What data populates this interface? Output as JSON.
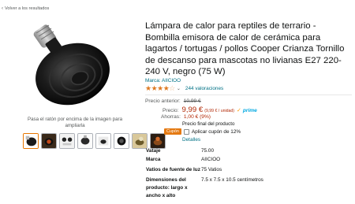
{
  "nav": {
    "back_label": "Volver a los resultados"
  },
  "gallery": {
    "hint": "Pasa el ratón por encima de la imagen para ampliarla",
    "thumbnail_count": 8
  },
  "product": {
    "title": "Lámpara de calor para reptiles de terrario - Bombilla emisora de calor de cerámica para lagartos / tortugas / pollos Cooper Crianza Tornillo de descanso para mascotas no livianas E27 220-240 V, negro (75 W)",
    "brand_link": "Marca: AIICIOO",
    "rating_stars": 4,
    "reviews": "244 valoraciones"
  },
  "pricing": {
    "previous_label": "Precio anterior:",
    "previous_value": "10,99 €",
    "price_label": "Precio:",
    "price_value": "9,99 €",
    "unit_price": "(9,99 € / unidad)",
    "prime": "prime",
    "savings_label": "Ahorras:",
    "savings_value": "1,00 € (9%)",
    "final_note": "Precio final del producto"
  },
  "coupon": {
    "badge": "Cupón",
    "apply_label": "Aplicar cupón de 12%",
    "details_link": "Detalles"
  },
  "specs": [
    {
      "key": "Vataje",
      "value": "75.00"
    },
    {
      "key": "Marca",
      "value": "AIICIOO"
    },
    {
      "key": "Vatios de fuente de luz",
      "value": "75 Vatios"
    },
    {
      "key": "Dimensiones del producto: largo x ancho x alto",
      "value": "7.5 x 7.5 x 10.5 centímetros"
    }
  ],
  "colors": {
    "link": "#007185",
    "price": "#b12704",
    "star": "#de7921",
    "prime": "#00a8e1",
    "coupon": "#e47911",
    "thumb_selected": "#e77600"
  }
}
